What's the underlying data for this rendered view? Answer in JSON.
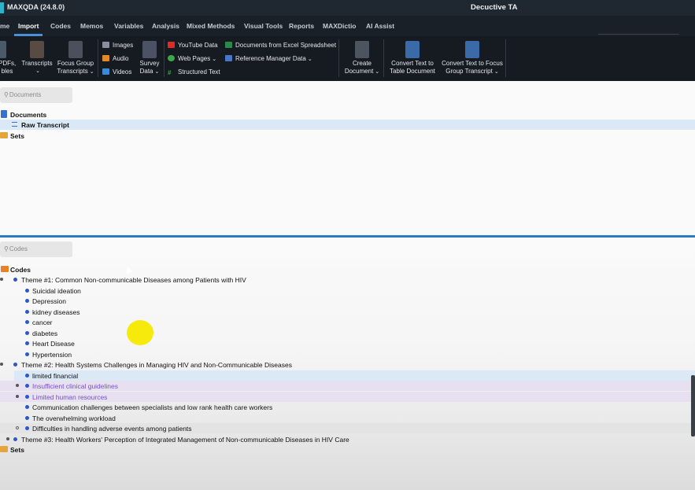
{
  "titlebar": {
    "app_title": "MAXQDA (24.8.0)",
    "project": "Decuctive TA"
  },
  "menu": [
    "me",
    "Import",
    "Codes",
    "Memos",
    "Variables",
    "Analysis",
    "Mixed Methods",
    "Visual Tools",
    "Reports",
    "MAXDictio",
    "AI Assist"
  ],
  "ribbon": {
    "pdfs": "PDFs,",
    "pdfs2": "bles",
    "transcripts": "Transcripts",
    "focus1": "Focus Group",
    "focus2": "Transcripts",
    "images": "Images",
    "audio": "Audio",
    "videos": "Videos",
    "survey1": "Survey",
    "survey2": "Data",
    "youtube": "YouTube Data",
    "webpages": "Web Pages",
    "structured": "Structured Text",
    "excel": "Documents from Excel Spreadsheet",
    "reference": "Reference Manager Data",
    "create1": "Create",
    "create2": "Document",
    "convert_table1": "Convert Text to",
    "convert_table2": "Table Document",
    "convert_focus1": "Convert Text to Focus",
    "convert_focus2": "Group Transcript"
  },
  "documents": {
    "search_placeholder": "Documents",
    "root": "Documents",
    "items": [
      "Raw Transcript"
    ],
    "sets": "Sets"
  },
  "codes": {
    "search_placeholder": "Codes",
    "root": "Codes",
    "themes": [
      {
        "label": "Theme #1: Common Non-communicable Diseases among Patients with HIV",
        "children": [
          "Suicidal ideation",
          "Depression",
          "kidney diseases",
          "cancer",
          "diabetes",
          "Heart Disease",
          "Hypertension"
        ]
      },
      {
        "label": "Theme #2: Health Systems Challenges in Managing HIV  and Non-Communicable Diseases",
        "children": [
          "limited financial",
          "Insufficient clinical guidelines",
          "Limited human resources",
          "Communication challenges between specialists and low rank health care workers",
          "The overwhelming workload",
          "Difficulties in handling adverse events among patients"
        ]
      },
      {
        "label": "Theme #3: Health Workers' Perception of Integrated Management of Non-communicable Diseases in HIV  Care",
        "children": []
      }
    ],
    "sets": "Sets"
  },
  "colors": {
    "accent": "#4a90d9",
    "code_dot": "#2a58c8",
    "purple_text": "#7a4fc4"
  },
  "icons": [
    "search-icon",
    "folder-icon",
    "document-icon",
    "code-dot-icon"
  ]
}
